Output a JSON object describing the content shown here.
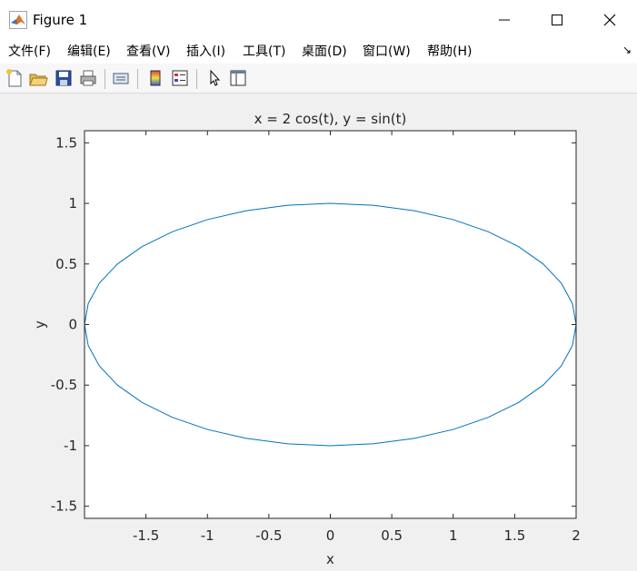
{
  "window": {
    "title": "Figure 1"
  },
  "menu": {
    "items": [
      "文件(F)",
      "编辑(E)",
      "查看(V)",
      "插入(I)",
      "工具(T)",
      "桌面(D)",
      "窗口(W)",
      "帮助(H)"
    ],
    "corner_icon": "dock-arrow-icon"
  },
  "toolbar": {
    "buttons": [
      "new-figure-icon",
      "open-file-icon",
      "save-icon",
      "print-icon",
      "link-plot-icon",
      "colorbar-icon",
      "legend-icon",
      "select-arrow-icon",
      "property-inspector-icon"
    ]
  },
  "colors": {
    "line": "#0072bd",
    "axes_text": "#262626",
    "background": "#f0f0f0",
    "axes_background": "#ffffff"
  },
  "chart_data": {
    "type": "line",
    "title": "x = 2 cos(t), y = sin(t)",
    "xlabel": "x",
    "ylabel": "y",
    "xlim": [
      -2,
      2
    ],
    "ylim": [
      -1.6,
      1.6
    ],
    "xticks": [
      -1.5,
      -1,
      -0.5,
      0,
      0.5,
      1,
      1.5,
      2
    ],
    "xtick_labels": [
      "-1.5",
      "-1",
      "-0.5",
      "0",
      "0.5",
      "1",
      "1.5",
      "2"
    ],
    "yticks": [
      -1.5,
      -1,
      -0.5,
      0,
      0.5,
      1,
      1.5
    ],
    "ytick_labels": [
      "-1.5",
      "-1",
      "-0.5",
      "0",
      "0.5",
      "1",
      "1.5"
    ],
    "grid": false,
    "series": [
      {
        "x": [
          2.0,
          1.9696,
          1.8794,
          1.7321,
          1.5321,
          1.2856,
          1.0,
          0.684,
          0.3473,
          0.0,
          -0.3473,
          -0.684,
          -1.0,
          -1.2856,
          -1.5321,
          -1.7321,
          -1.8794,
          -1.9696,
          -2.0,
          -1.9696,
          -1.8794,
          -1.7321,
          -1.5321,
          -1.2856,
          -1.0,
          -0.684,
          -0.3473,
          0.0,
          0.3473,
          0.684,
          1.0,
          1.2856,
          1.5321,
          1.7321,
          1.8794,
          1.9696,
          2.0
        ],
        "y": [
          0.0,
          0.1736,
          0.342,
          0.5,
          0.6428,
          0.766,
          0.866,
          0.9397,
          0.9848,
          1.0,
          0.9848,
          0.9397,
          0.866,
          0.766,
          0.6428,
          0.5,
          0.342,
          0.1736,
          0.0,
          -0.1736,
          -0.342,
          -0.5,
          -0.6428,
          -0.766,
          -0.866,
          -0.9397,
          -0.9848,
          -1.0,
          -0.9848,
          -0.9397,
          -0.866,
          -0.766,
          -0.6428,
          -0.5,
          -0.342,
          -0.1736,
          0.0
        ]
      }
    ]
  }
}
